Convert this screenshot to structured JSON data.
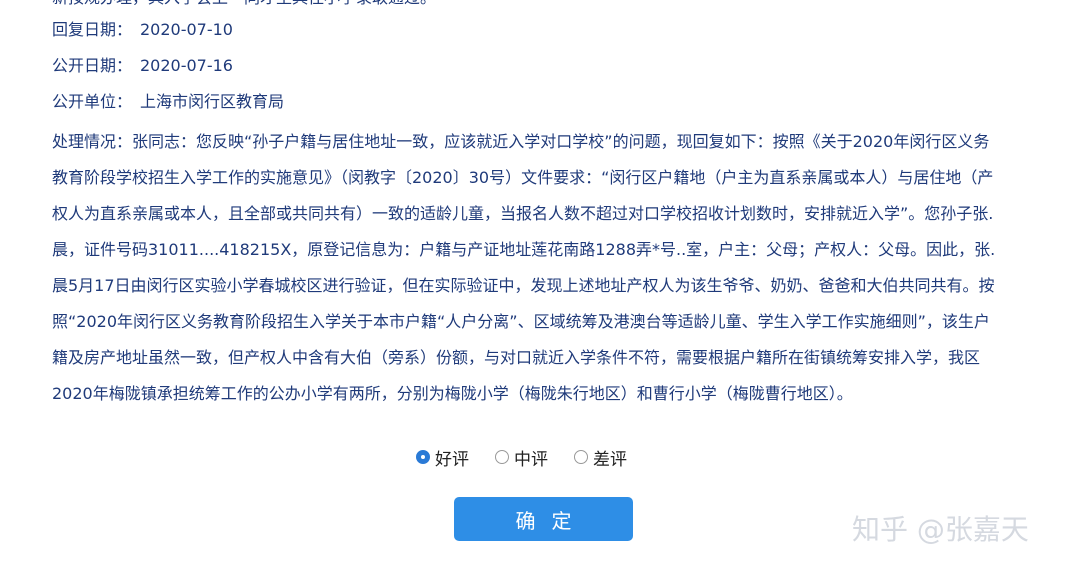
{
  "header_cut_text": "新按规办理，具入学会上一同才生具往小学录取通过。",
  "reply": {
    "label": "回复日期：",
    "value": "2020-07-10"
  },
  "publish": {
    "label": "公开日期：",
    "value": "2020-07-16"
  },
  "unit": {
    "label": "公开单位：",
    "value": "上海市闵行区教育局"
  },
  "handling": {
    "label": "处理情况：",
    "text": "张同志：您反映“孙子户籍与居住地址一致，应该就近入学对口学校”的问题，现回复如下：按照《关于2020年闵行区义务教育阶段学校招生入学工作的实施意见》（闵教字〔2020〕30号）文件要求：“闵行区户籍地（户主为直系亲属或本人）与居住地（产权人为直系亲属或本人，且全部或共同共有）一致的适龄儿童，当报名人数不超过对口学校招收计划数时，安排就近入学”。您孙子张.晨，证件号码31011....418215X，原登记信息为：户籍与产证地址莲花南路1288弄*号..室，户主：父母；产权人：父母。因此，张.晨5月17日由闵行区实验小学春城校区进行验证，但在实际验证中，发现上述地址产权人为该生爷爷、奶奶、爸爸和大伯共同共有。按照“2020年闵行区义务教育阶段招生入学关于本市户籍“人户分离”、区域统筹及港澳台等适龄儿童、学生入学工作实施细则”，该生户籍及房产地址虽然一致，但产权人中含有大伯（旁系）份额，与对口就近入学条件不符，需要根据户籍所在街镇统筹安排入学，我区2020年梅陇镇承担统筹工作的公办小学有两所，分别为梅陇小学（梅陇朱行地区）和曹行小学（梅陇曹行地区）。"
  },
  "rating": {
    "options": [
      "好评",
      "中评",
      "差评"
    ],
    "selected": "好评"
  },
  "confirm_label": "确定",
  "watermark": "知乎 @张嘉天",
  "colors": {
    "text": "#1f3a7a",
    "button": "#2e8ee6",
    "radio_on": "#2a7ad6"
  }
}
